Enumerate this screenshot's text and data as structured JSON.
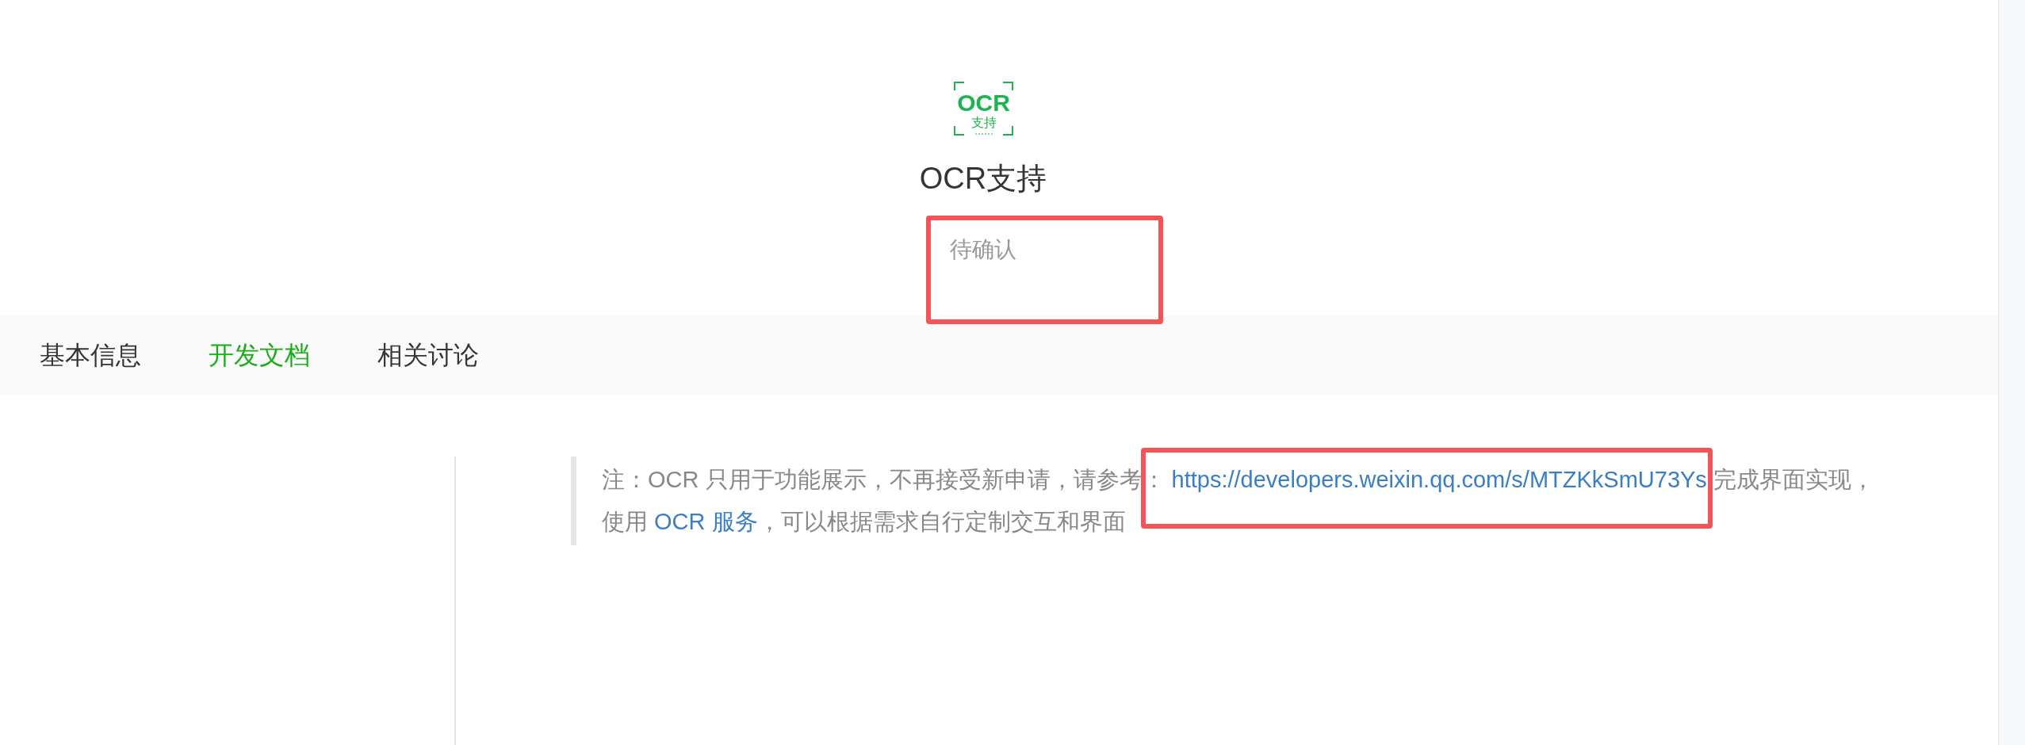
{
  "header": {
    "logo": {
      "text": "OCR",
      "subtext": "支持"
    },
    "title": "OCR支持",
    "status": {
      "text": "待确认",
      "highlighted": true
    }
  },
  "tabs": [
    {
      "label": "基本信息",
      "selected": false
    },
    {
      "label": "开发文档",
      "selected": true
    },
    {
      "label": "相关讨论",
      "selected": false
    }
  ],
  "note": {
    "parts": [
      {
        "kind": "text",
        "text": "注：OCR 只用于功能展示，不再接受新申请，请参考： "
      },
      {
        "kind": "link",
        "text": "https://developers.weixin.qq.com/s/MTZKkSmU73Ys",
        "highlighted": true
      },
      {
        "kind": "text",
        "text": " 完成界面实现，使用 "
      },
      {
        "kind": "link",
        "text": "OCR 服务",
        "highlighted": false
      },
      {
        "kind": "text",
        "text": "，可以根据需求自行定制交互和界面"
      }
    ]
  }
}
